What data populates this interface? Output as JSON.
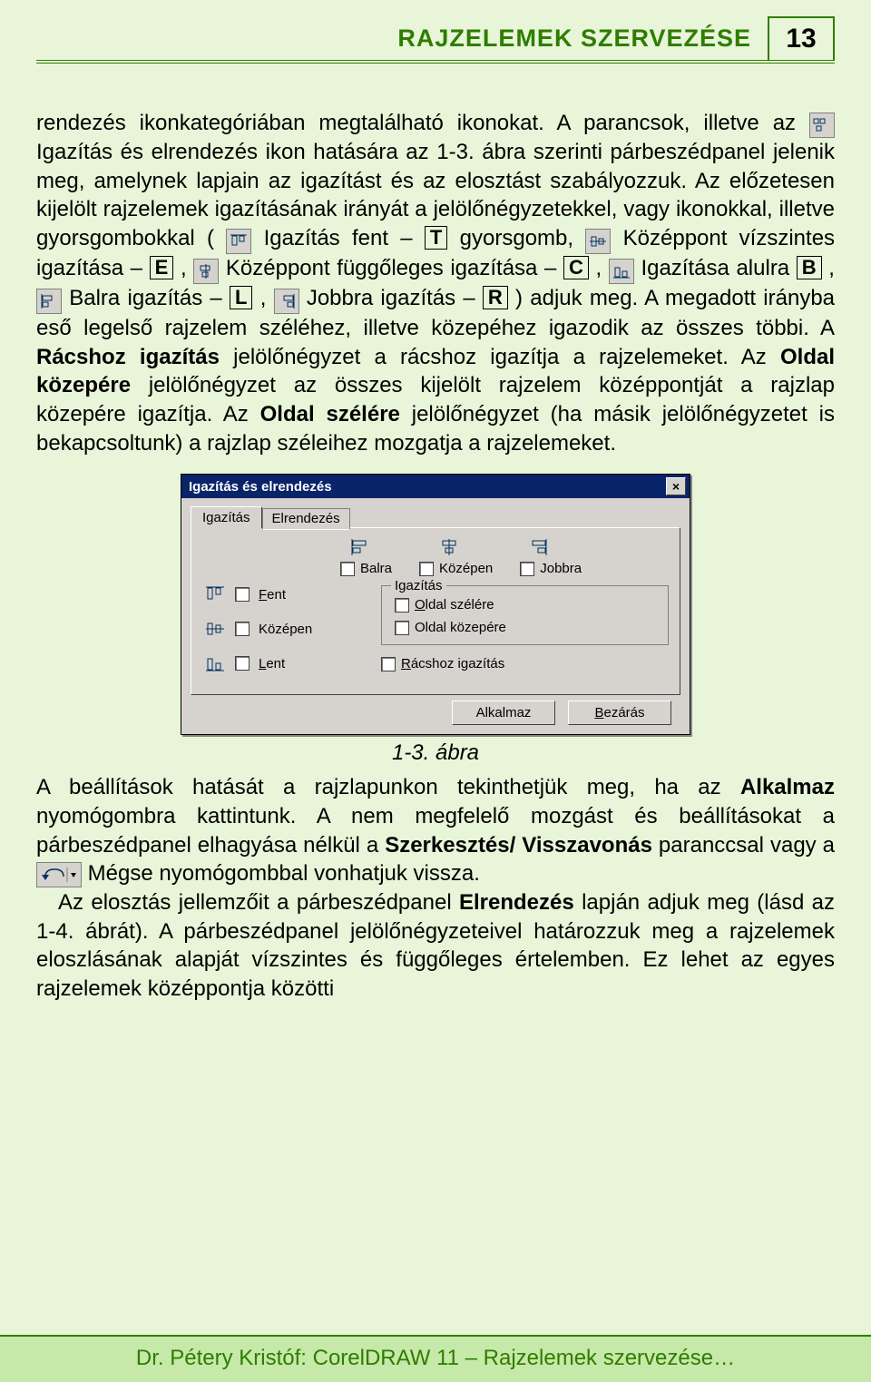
{
  "header": {
    "title": "RAJZELEMEK SZERVEZÉSE",
    "page_number": "13"
  },
  "paragraphs": {
    "p1a": "rendezés ikonkategóriában megtalálható ikonokat. A parancsok, illetve az ",
    "p1b": " Igazítás és elrendezés ikon hatására az 1-3. ábra szerinti párbeszédpanel jelenik meg, amelynek lapjain az igazítást és az elosztást szabályozzuk. Az előzetesen kijelölt rajzelemek igazításának irányát a jelölőnégyzetekkel, vagy ikonokkal, illetve gyorsgombokkal (",
    "p1c": " Igazítás fent – ",
    "key_T": "T",
    "p1d": " gyorsgomb, ",
    "p1e": " Középpont vízszintes igazítása – ",
    "key_E": "E",
    "p1f": ", ",
    "p1g": " Középpont függőleges igazítása – ",
    "key_C": "C",
    "p1h": ", ",
    "p1i": " Igazítása alulra ",
    "key_B": "B",
    "p1j": ", ",
    "p1k": " Balra igazítás – ",
    "key_L": "L",
    "p1l": ", ",
    "p1m": " Jobbra igazítás – ",
    "key_R": "R",
    "p1n": ") adjuk meg. A megadott irányba eső legelső rajzelem széléhez, illetve közepéhez igazodik az összes többi. A ",
    "bold_racs": "Rácshoz igazítás",
    "p1o": " jelölőnégyzet a rácshoz igazítja a rajzelemeket. Az ",
    "bold_oldalkozep": "Oldal közepére",
    "p1p": " jelölőnégyzet az összes kijelölt rajzelem középpontját a rajzlap közepére igazítja. Az ",
    "bold_oldalszel": "Oldal szélére",
    "p1q": " jelölőnégyzet (ha másik jelölőnégyzetet is bekapcsoltunk) a rajzlap széleihez mozgatja a rajzelemeket."
  },
  "dialog": {
    "title": "Igazítás és elrendezés",
    "close_label": "×",
    "tabs": {
      "active": "Igazítás",
      "inactive": "Elrendezés"
    },
    "top": {
      "balra": "Balra",
      "kozepen": "Középen",
      "jobbra": "Jobbra"
    },
    "left": {
      "fent": "Fent",
      "kozepen": "Középen",
      "lent": "Lent"
    },
    "group": {
      "legend": "Igazítás",
      "oldal_szelere": "Oldal szélére",
      "oldal_kozepere": "Oldal közepére"
    },
    "racshoz": "Rácshoz igazítás",
    "buttons": {
      "alkalmaz": "Alkalmaz",
      "bezaras": "Bezárás"
    }
  },
  "figure_caption": "1-3. ábra",
  "paragraphs2": {
    "p2a": "A beállítások hatását a rajzlapunkon tekinthetjük meg, ha az  ",
    "bold_alkalmaz": "Alkalmaz",
    "p2b": " nyomógombra kattintunk. A nem megfelelő mozgást és beállításokat a párbeszédpanel elhagyása nélkül a ",
    "bold_szerk": "Szerkesztés/ Visszavonás",
    "p2c": " paranccsal vagy a ",
    "p2d": " Mégse nyomógombbal vonhatjuk vissza.",
    "p3a": "Az elosztás jellemzőit a párbeszédpanel ",
    "bold_elrend": "Elrendezés",
    "p3b": " lapján adjuk meg (lásd az 1-4. ábrát). A párbeszédpanel jelölőnégyzeteivel határozzuk meg a rajzelemek eloszlásának alapját vízszintes és függőleges értelemben. Ez lehet az egyes rajzelemek középpontja közötti"
  },
  "footer": "Dr. Pétery Kristóf: CorelDRAW 11 – Rajzelemek szervezése…"
}
